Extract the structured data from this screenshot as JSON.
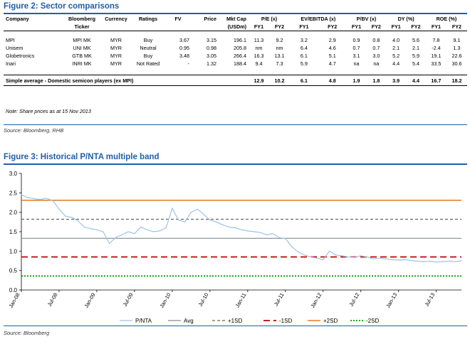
{
  "fig2": {
    "title": "Figure 2:  Sector comparisons",
    "headers1": [
      "Company",
      "Bloomberg",
      "Currency",
      "Ratings",
      "FV",
      "Price",
      "Mkt Cap",
      "P/E (x)",
      "EV/EBITDA (x)",
      "P/BV (x)",
      "DY (%)",
      "ROE (%)"
    ],
    "headers2": [
      "",
      "Ticker",
      "",
      "",
      "",
      "",
      "(USDm)",
      "FY1",
      "FY2",
      "FY1",
      "FY2",
      "FY1",
      "FY2",
      "FY1",
      "FY2",
      "FY1",
      "FY2"
    ],
    "rows": [
      [
        "MPI",
        "MPI MK",
        "MYR",
        "Buy",
        "3.67",
        "3.15",
        "196.1",
        "11.3",
        "9.2",
        "3.2",
        "2.9",
        "0.9",
        "0.8",
        "4.0",
        "5.6",
        "7.8",
        "9.1"
      ],
      [
        "Unisem",
        "UNI MK",
        "MYR",
        "Neutral",
        "0.95",
        "0.98",
        "205.8",
        "nm",
        "nm",
        "6.4",
        "4.6",
        "0.7",
        "0.7",
        "2.1",
        "2.1",
        "-2.4",
        "1.3"
      ],
      [
        "Globetronics",
        "GTB MK",
        "MYR",
        "Buy",
        "3.48",
        "3.05",
        "266.4",
        "16.3",
        "13.1",
        "6.1",
        "5.1",
        "3.1",
        "3.0",
        "5.2",
        "5.9",
        "19.1",
        "22.6"
      ],
      [
        "Inari",
        "INRI MK",
        "MYR",
        "Not Rated",
        "-",
        "1.32",
        "188.4",
        "9.4",
        "7.3",
        "5.9",
        "4.7",
        "na",
        "na",
        "4.4",
        "5.4",
        "33.5",
        "30.6"
      ]
    ],
    "average": {
      "label": "Simple average - Domestic semicon players (ex MPI)",
      "values": [
        "12.9",
        "10.2",
        "6.1",
        "4.8",
        "1.9",
        "1.8",
        "3.9",
        "4.4",
        "16.7",
        "18.2"
      ]
    },
    "note": "Note: Share prices as at 15 Nov 2013",
    "source": "Source: Bloomberg, RHB"
  },
  "fig3": {
    "title": "Figure 3:  Historical P/NTA multiple band",
    "source": "Source: Bloomberg"
  },
  "chart_data": {
    "type": "line",
    "title": "Historical P/NTA multiple band",
    "xlabel": "",
    "ylabel": "",
    "ylim": [
      0,
      3.0
    ],
    "yticks": [
      "0.0",
      "0.5",
      "1.0",
      "1.5",
      "2.0",
      "2.5",
      "3.0"
    ],
    "xticks": [
      "Jan-08",
      "Jul-08",
      "Jan-09",
      "Jul-09",
      "Jan-10",
      "Jul-10",
      "Jan-11",
      "Jul-11",
      "Jan-12",
      "Jul-12",
      "Jan-13",
      "Jul-13"
    ],
    "xrange": [
      "2008-01",
      "2013-11"
    ],
    "grid": false,
    "legend_position": "bottom",
    "colors": {
      "pnta": "#9dc3e6",
      "avg": "#7f8c99",
      "plus1sd": "#666666",
      "minus1sd": "#c00000",
      "plus2sd": "#e07b1f",
      "minus2sd": "#00a000"
    },
    "series": [
      {
        "name": "P/NTA",
        "style": "solid",
        "points": [
          [
            "2008-01",
            2.45
          ],
          [
            "2008-02",
            2.38
          ],
          [
            "2008-03",
            2.35
          ],
          [
            "2008-04",
            2.33
          ],
          [
            "2008-05",
            2.36
          ],
          [
            "2008-06",
            2.3
          ],
          [
            "2008-07",
            2.08
          ],
          [
            "2008-08",
            1.9
          ],
          [
            "2008-09",
            1.87
          ],
          [
            "2008-10",
            1.78
          ],
          [
            "2008-11",
            1.62
          ],
          [
            "2008-12",
            1.58
          ],
          [
            "2009-01",
            1.55
          ],
          [
            "2009-02",
            1.5
          ],
          [
            "2009-03",
            1.2
          ],
          [
            "2009-04",
            1.35
          ],
          [
            "2009-05",
            1.42
          ],
          [
            "2009-06",
            1.5
          ],
          [
            "2009-07",
            1.45
          ],
          [
            "2009-08",
            1.62
          ],
          [
            "2009-09",
            1.55
          ],
          [
            "2009-10",
            1.5
          ],
          [
            "2009-11",
            1.52
          ],
          [
            "2009-12",
            1.6
          ],
          [
            "2010-01",
            2.1
          ],
          [
            "2010-02",
            1.8
          ],
          [
            "2010-03",
            1.75
          ],
          [
            "2010-04",
            2.0
          ],
          [
            "2010-05",
            2.08
          ],
          [
            "2010-06",
            1.95
          ],
          [
            "2010-07",
            1.8
          ],
          [
            "2010-08",
            1.75
          ],
          [
            "2010-09",
            1.68
          ],
          [
            "2010-10",
            1.62
          ],
          [
            "2010-11",
            1.6
          ],
          [
            "2010-12",
            1.55
          ],
          [
            "2011-01",
            1.52
          ],
          [
            "2011-02",
            1.5
          ],
          [
            "2011-03",
            1.48
          ],
          [
            "2011-04",
            1.42
          ],
          [
            "2011-05",
            1.45
          ],
          [
            "2011-06",
            1.35
          ],
          [
            "2011-07",
            1.32
          ],
          [
            "2011-08",
            1.12
          ],
          [
            "2011-09",
            0.98
          ],
          [
            "2011-10",
            0.9
          ],
          [
            "2011-11",
            0.85
          ],
          [
            "2011-12",
            0.82
          ],
          [
            "2012-01",
            0.78
          ],
          [
            "2012-02",
            1.0
          ],
          [
            "2012-03",
            0.9
          ],
          [
            "2012-04",
            0.88
          ],
          [
            "2012-05",
            0.85
          ],
          [
            "2012-06",
            0.84
          ],
          [
            "2012-07",
            0.88
          ],
          [
            "2012-08",
            0.85
          ],
          [
            "2012-09",
            0.8
          ],
          [
            "2012-10",
            0.82
          ],
          [
            "2012-11",
            0.8
          ],
          [
            "2012-12",
            0.78
          ],
          [
            "2013-01",
            0.77
          ],
          [
            "2013-02",
            0.78
          ],
          [
            "2013-03",
            0.76
          ],
          [
            "2013-04",
            0.74
          ],
          [
            "2013-05",
            0.73
          ],
          [
            "2013-06",
            0.74
          ],
          [
            "2013-07",
            0.72
          ],
          [
            "2013-08",
            0.73
          ],
          [
            "2013-09",
            0.74
          ],
          [
            "2013-10",
            0.73
          ],
          [
            "2013-11",
            0.75
          ]
        ]
      },
      {
        "name": "Avg",
        "style": "solid",
        "value": 1.33
      },
      {
        "name": "+1SD",
        "style": "dash",
        "value": 1.82
      },
      {
        "name": "-1SD",
        "style": "longdash",
        "value": 0.85
      },
      {
        "name": "+2SD",
        "style": "solid",
        "value": 2.31
      },
      {
        "name": "-2SD",
        "style": "dot",
        "value": 0.36
      }
    ]
  }
}
